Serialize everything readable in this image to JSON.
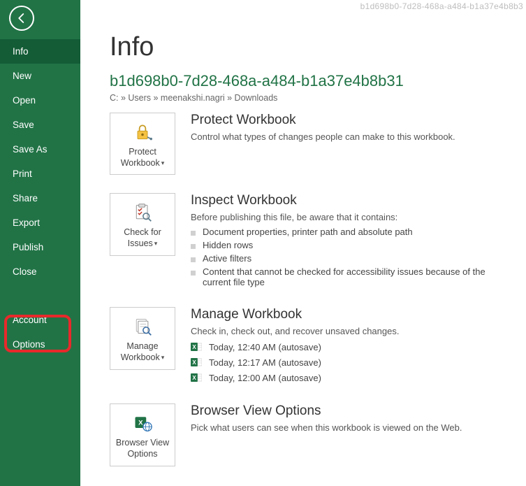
{
  "top_doc_id": "b1d698b0-7d28-468a-a484-b1a37e4b8b3",
  "sidebar": {
    "items": [
      {
        "label": "Info",
        "active": true,
        "name": "sidebar-item-info"
      },
      {
        "label": "New",
        "active": false,
        "name": "sidebar-item-new"
      },
      {
        "label": "Open",
        "active": false,
        "name": "sidebar-item-open"
      },
      {
        "label": "Save",
        "active": false,
        "name": "sidebar-item-save"
      },
      {
        "label": "Save As",
        "active": false,
        "name": "sidebar-item-save-as"
      },
      {
        "label": "Print",
        "active": false,
        "name": "sidebar-item-print"
      },
      {
        "label": "Share",
        "active": false,
        "name": "sidebar-item-share"
      },
      {
        "label": "Export",
        "active": false,
        "name": "sidebar-item-export"
      },
      {
        "label": "Publish",
        "active": false,
        "name": "sidebar-item-publish"
      },
      {
        "label": "Close",
        "active": false,
        "name": "sidebar-item-close"
      },
      {
        "label": "Account",
        "active": false,
        "name": "sidebar-item-account",
        "gap": true
      },
      {
        "label": "Options",
        "active": false,
        "name": "sidebar-item-options"
      }
    ]
  },
  "page_title": "Info",
  "doc_name": "b1d698b0-7d28-468a-a484-b1a37e4b8b31",
  "doc_path": "C: » Users » meenakshi.nagri » Downloads",
  "sections": {
    "protect": {
      "btn_label": "Protect Workbook",
      "title": "Protect Workbook",
      "desc": "Control what types of changes people can make to this workbook."
    },
    "inspect": {
      "btn_label": "Check for Issues",
      "title": "Inspect Workbook",
      "desc": "Before publishing this file, be aware that it contains:",
      "bullets": [
        "Document properties, printer path and absolute path",
        "Hidden rows",
        "Active filters",
        "Content that cannot be checked for accessibility issues because of the current file type"
      ]
    },
    "manage": {
      "btn_label": "Manage Workbook",
      "title": "Manage Workbook",
      "desc": "Check in, check out, and recover unsaved changes.",
      "versions": [
        "Today, 12:40 AM (autosave)",
        "Today, 12:17 AM (autosave)",
        "Today, 12:00 AM (autosave)"
      ]
    },
    "browser": {
      "btn_label": "Browser View Options",
      "title": "Browser View Options",
      "desc": "Pick what users can see when this workbook is viewed on the Web."
    }
  }
}
